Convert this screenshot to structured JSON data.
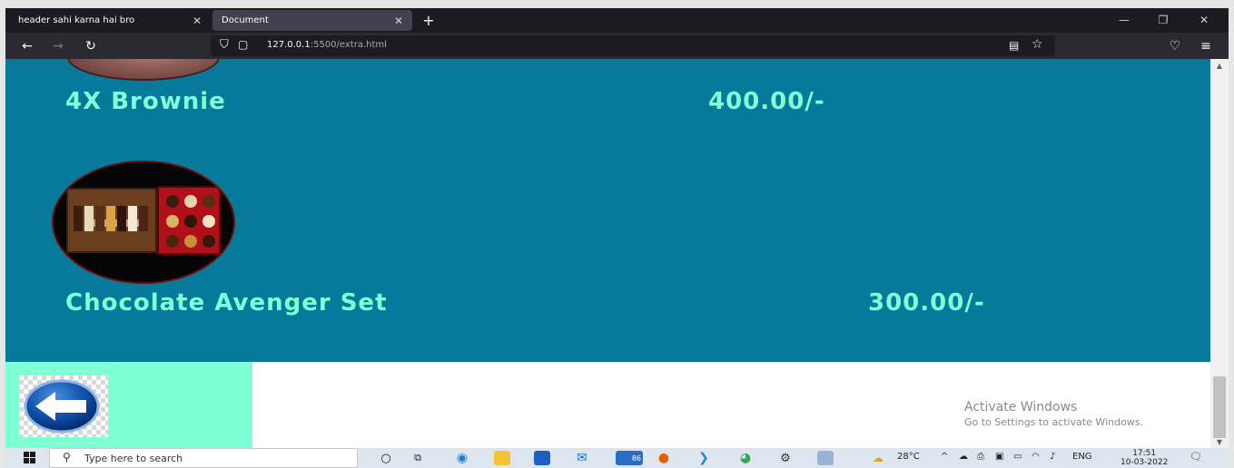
{
  "browser": {
    "tabs": [
      {
        "title": "header sahi karna hai bro",
        "active": false
      },
      {
        "title": "Document",
        "active": true
      }
    ],
    "new_tab_label": "+",
    "url_host": "127.0.0.1",
    "url_path": ":5500/extra.html"
  },
  "products": [
    {
      "name": "4X Brownie",
      "price": "400.00/-"
    },
    {
      "name": "Chocolate Avenger Set",
      "price": "300.00/-"
    }
  ],
  "watermark": {
    "title": "Activate Windows",
    "subtitle": "Go to Settings to activate Windows."
  },
  "taskbar": {
    "search_placeholder": "Type here to search",
    "badge_count": "86",
    "weather": "28°C",
    "language": "ENG",
    "time": "17:51",
    "date": "10-03-2022"
  },
  "colors": {
    "content_bg": "#077a9b",
    "text_accent": "#7fffd4",
    "back_panel_bg": "#7fffd4"
  }
}
